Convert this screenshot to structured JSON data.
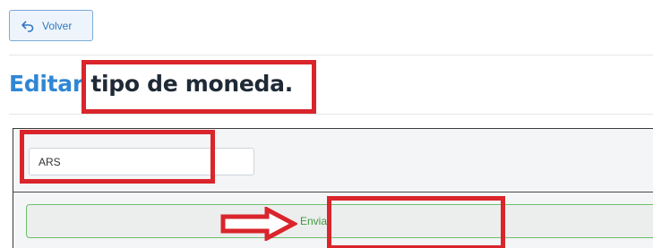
{
  "toolbar": {
    "back_label": "Volver",
    "back_icon": "back-arrow-icon"
  },
  "page": {
    "title_accent": "Editar",
    "title_rest": "tipo de moneda."
  },
  "form": {
    "currency_value": "ARS",
    "submit_label": "Enviar"
  },
  "colors": {
    "accent": "#2f86d4",
    "annotation": "#d9252b",
    "submit_border": "#6dbf6d",
    "submit_text": "#3f9a3f"
  }
}
